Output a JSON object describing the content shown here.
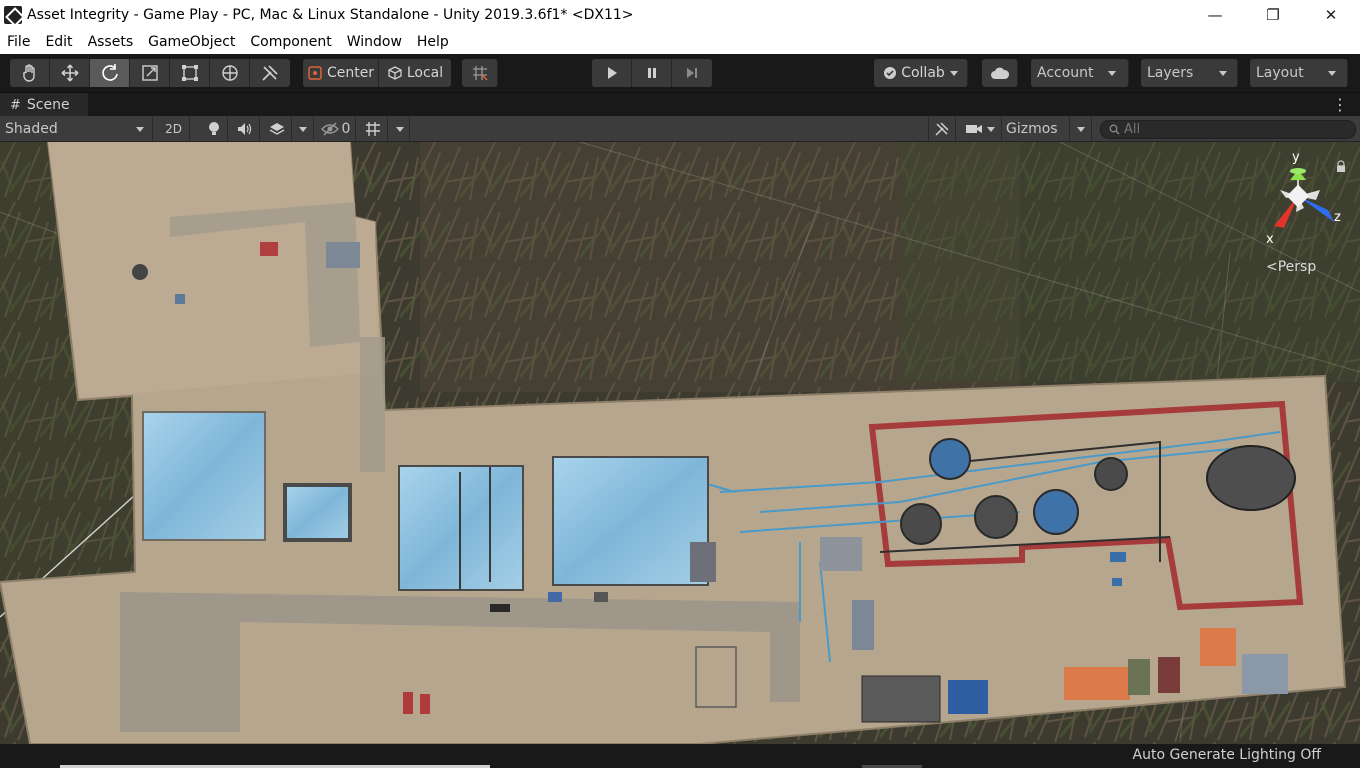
{
  "window": {
    "title": "Asset Integrity - Game Play - PC, Mac & Linux Standalone - Unity 2019.3.6f1* <DX11>",
    "minimize": "—",
    "maximize": "❐",
    "close": "✕"
  },
  "menu": {
    "items": [
      "File",
      "Edit",
      "Assets",
      "GameObject",
      "Component",
      "Window",
      "Help"
    ]
  },
  "toolbar": {
    "tools": [
      "hand-tool",
      "move-tool",
      "rotate-tool",
      "scale-tool",
      "rect-tool",
      "transform-tool",
      "custom-tool"
    ],
    "pivot_mode": "Center",
    "pivot_rotation": "Local",
    "collab": "Collab",
    "account": "Account",
    "layers": "Layers",
    "layout": "Layout"
  },
  "scene_tab": {
    "label": "Scene"
  },
  "scene_toolbar": {
    "draw_mode": "Shaded",
    "mode_2d": "2D",
    "hidden_count": "0",
    "gizmos": "Gizmos",
    "search_placeholder": "All"
  },
  "gizmo": {
    "y": "y",
    "x": "x",
    "z": "z",
    "projection": "Persp"
  },
  "status": {
    "text": "Auto Generate Lighting Off"
  },
  "colors": {
    "editor_bg": "#191919",
    "toolbar_btn": "#3a3a3a",
    "toolbar_active": "#5a5a5a",
    "scene_bar": "#3c3c3c",
    "ground": "#b7a68e",
    "water": "#8ec3e0",
    "red_pipe": "#a63b3b",
    "vegetation": "#3f3a2e"
  }
}
